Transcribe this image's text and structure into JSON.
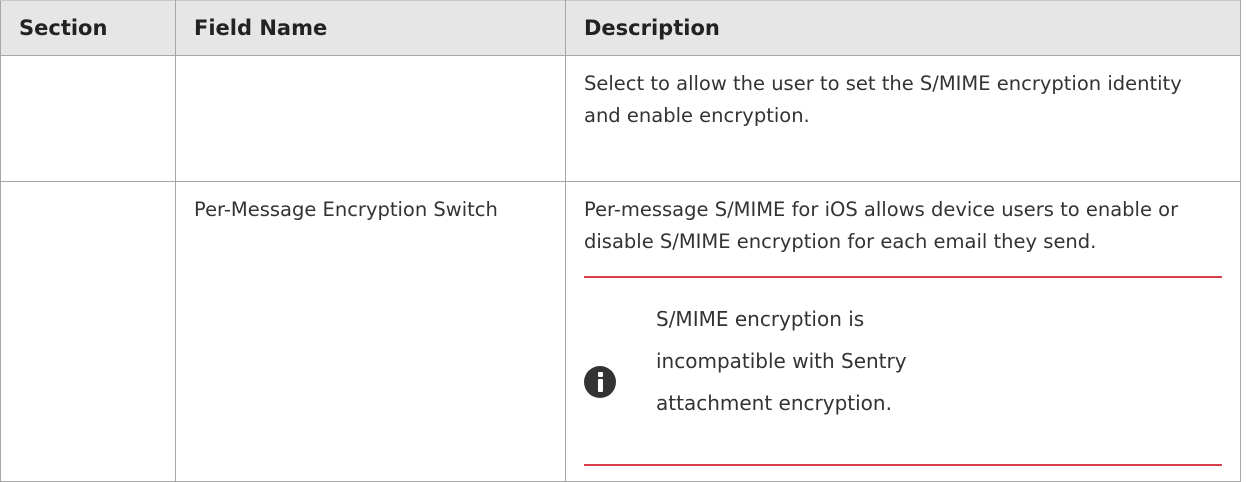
{
  "table": {
    "headers": [
      "Section",
      "Field Name",
      "Description"
    ],
    "rows": [
      {
        "section": "",
        "field_name": "",
        "description": "Select to allow the user to set the S/MIME encryption identity and enable encryption."
      },
      {
        "section": "",
        "field_name": "Per-Message Encryption Switch",
        "description": "Per-message S/MIME for iOS allows device users to enable or disable S/MIME encryption for each email they send.",
        "note": {
          "icon": "info-icon",
          "text": "S/MIME encryption is incompatible with Sentry attachment encryption."
        }
      }
    ]
  },
  "colors": {
    "header_background": "#e6e6e6",
    "border": "#a6a6a6",
    "note_rule": "#d6404a",
    "info_icon": "#333333"
  }
}
